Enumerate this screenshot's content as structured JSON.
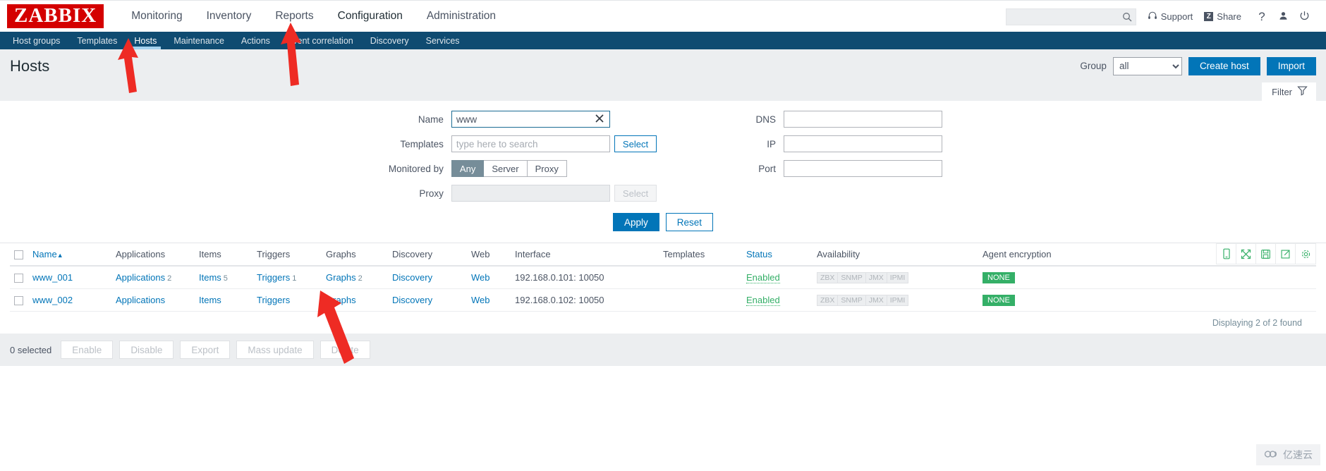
{
  "app": {
    "logo": "ZABBIX",
    "main_nav": [
      {
        "label": "Monitoring",
        "active": false
      },
      {
        "label": "Inventory",
        "active": false
      },
      {
        "label": "Reports",
        "active": false
      },
      {
        "label": "Configuration",
        "active": true
      },
      {
        "label": "Administration",
        "active": false
      }
    ],
    "search": {
      "value": "",
      "placeholder": ""
    },
    "support_label": "Support",
    "share_label": "Share",
    "share_badge": "Z",
    "help_label": "?",
    "sub_nav": [
      {
        "label": "Host groups",
        "active": false
      },
      {
        "label": "Templates",
        "active": false
      },
      {
        "label": "Hosts",
        "active": true
      },
      {
        "label": "Maintenance",
        "active": false
      },
      {
        "label": "Actions",
        "active": false
      },
      {
        "label": "Event correlation",
        "active": false
      },
      {
        "label": "Discovery",
        "active": false
      },
      {
        "label": "Services",
        "active": false
      }
    ]
  },
  "page": {
    "title": "Hosts",
    "group_label": "Group",
    "group_value": "all",
    "group_options": [
      "all"
    ],
    "create_host_label": "Create host",
    "import_label": "Import",
    "filter_tab_label": "Filter"
  },
  "filter": {
    "name_label": "Name",
    "name_value": "www",
    "templates_label": "Templates",
    "templates_value": "",
    "templates_placeholder": "type here to search",
    "templates_select_label": "Select",
    "monitored_by_label": "Monitored by",
    "monitored_by_options": [
      "Any",
      "Server",
      "Proxy"
    ],
    "monitored_by_selected": "Any",
    "proxy_label": "Proxy",
    "proxy_value": "",
    "proxy_select_label": "Select",
    "dns_label": "DNS",
    "dns_value": "",
    "ip_label": "IP",
    "ip_value": "",
    "port_label": "Port",
    "port_value": "",
    "apply_label": "Apply",
    "reset_label": "Reset"
  },
  "table": {
    "columns": [
      "Name",
      "Applications",
      "Items",
      "Triggers",
      "Graphs",
      "Discovery",
      "Web",
      "Interface",
      "Templates",
      "Status",
      "Availability",
      "Agent encryption"
    ],
    "sort_column": "Name",
    "sort_direction": "asc",
    "sort_arrow": "▲",
    "availability_badges": [
      "ZBX",
      "SNMP",
      "JMX",
      "IPMI"
    ],
    "rows": [
      {
        "name": "www_001",
        "applications": "Applications",
        "applications_count": "2",
        "items": "Items",
        "items_count": "5",
        "triggers": "Triggers",
        "triggers_count": "1",
        "graphs": "Graphs",
        "graphs_count": "2",
        "discovery": "Discovery",
        "web": "Web",
        "interface": "192.168.0.101: 10050",
        "templates": "",
        "status": "Enabled",
        "encryption": "NONE"
      },
      {
        "name": "www_002",
        "applications": "Applications",
        "applications_count": "",
        "items": "Items",
        "items_count": "",
        "triggers": "Triggers",
        "triggers_count": "",
        "graphs": "Graphs",
        "graphs_count": "",
        "discovery": "Discovery",
        "web": "Web",
        "interface": "192.168.0.102: 10050",
        "templates": "",
        "status": "Enabled",
        "encryption": "NONE"
      }
    ],
    "displaying": "Displaying 2 of 2 found"
  },
  "footer": {
    "selected_label": "0 selected",
    "buttons": [
      "Enable",
      "Disable",
      "Export",
      "Mass update",
      "Delete"
    ]
  },
  "toolbar_icons": [
    "kiosk-icon",
    "fullscreen-icon",
    "save-icon",
    "export-icon",
    "gear-icon"
  ],
  "watermark": {
    "text": "亿速云"
  },
  "colors": {
    "brand_red": "#d40000",
    "nav_blue": "#0f4b71",
    "link_blue": "#0275b8",
    "status_green": "#34AF67",
    "annotation_red": "#ee2b24"
  }
}
